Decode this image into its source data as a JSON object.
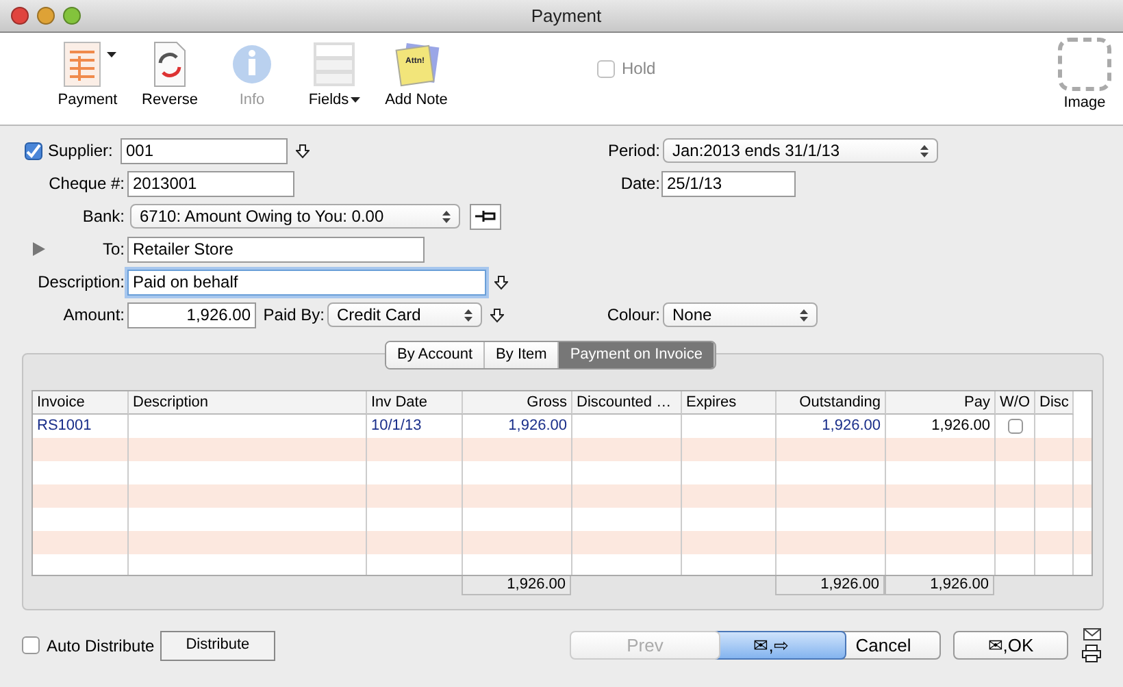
{
  "window": {
    "title": "Payment"
  },
  "toolbar": {
    "items": [
      {
        "label": "Payment",
        "kind": "menu",
        "disabled": false
      },
      {
        "label": "Reverse",
        "kind": "button",
        "disabled": false
      },
      {
        "label": "Info",
        "kind": "button",
        "disabled": true
      },
      {
        "label": "Fields",
        "kind": "menu",
        "disabled": false
      },
      {
        "label": "Add Note",
        "kind": "button",
        "disabled": false,
        "icon_text": "Attn!"
      }
    ],
    "hold": {
      "label": "Hold",
      "checked": false,
      "disabled": true
    },
    "image": {
      "label": "Image"
    }
  },
  "form": {
    "supplier": {
      "label": "Supplier:",
      "checked": true,
      "value": "001"
    },
    "cheque": {
      "label": "Cheque #:",
      "value": "2013001"
    },
    "bank": {
      "label": "Bank:",
      "value": "6710: Amount Owing to You: 0.00"
    },
    "to": {
      "label": "To:",
      "value": "Retailer Store",
      "expanded": false
    },
    "description": {
      "label": "Description:",
      "value": "Paid on behalf",
      "focused": true
    },
    "amount": {
      "label": "Amount:",
      "value": "1,926.00"
    },
    "paid_by": {
      "label": "Paid By:",
      "value": "Credit Card"
    },
    "period": {
      "label": "Period:",
      "value": "Jan:2013 ends 31/1/13"
    },
    "date": {
      "label": "Date:",
      "value": "25/1/13"
    },
    "colour": {
      "label": "Colour:",
      "value": "None"
    }
  },
  "tabs": [
    {
      "label": "By Account",
      "selected": false
    },
    {
      "label": "By Item",
      "selected": false
    },
    {
      "label": "Payment on Invoice",
      "selected": true
    }
  ],
  "table": {
    "columns": [
      {
        "label": "Invoice",
        "kind": "text"
      },
      {
        "label": "Description",
        "kind": "text"
      },
      {
        "label": "Inv Date",
        "kind": "text"
      },
      {
        "label": "Gross",
        "kind": "amount",
        "total": "1,926.00"
      },
      {
        "label": "Discounted …",
        "kind": "text"
      },
      {
        "label": "Expires",
        "kind": "text"
      },
      {
        "label": "Outstanding",
        "kind": "amount",
        "total": "1,926.00"
      },
      {
        "label": "Pay",
        "kind": "entry",
        "total": "1,926.00"
      },
      {
        "label": "W/O",
        "kind": "check"
      },
      {
        "label": "Disc",
        "kind": "text"
      }
    ],
    "rows": [
      {
        "cells": [
          "RS1001",
          "",
          "10/1/13",
          "1,926.00",
          "",
          "",
          "1,926.00",
          "1,926.00",
          {
            "checked": false
          },
          ""
        ]
      }
    ]
  },
  "bottom": {
    "auto_distribute": {
      "label": "Auto Distribute",
      "checked": false
    },
    "distribute": "Distribute",
    "buttons": [
      {
        "label": "Prev",
        "disabled": true,
        "default": false
      },
      {
        "label": "✉,⇨",
        "disabled": false,
        "default": true
      },
      {
        "label": "Cancel",
        "disabled": false,
        "default": false
      },
      {
        "label": "✉,OK",
        "disabled": false,
        "default": false
      }
    ]
  }
}
